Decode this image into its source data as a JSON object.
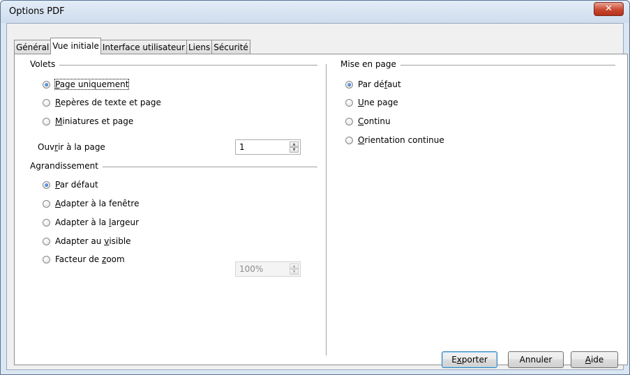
{
  "window": {
    "title": "Options PDF",
    "close_glyph": "✕"
  },
  "tabs": [
    "Général",
    "Vue initiale",
    "Interface utilisateur",
    "Liens",
    "Sécurité"
  ],
  "volets": {
    "title": "Volets",
    "options": [
      {
        "pre": "",
        "key": "P",
        "post": "age uniquement",
        "selected": true
      },
      {
        "pre": "",
        "key": "R",
        "post": "epères de texte et page",
        "selected": false
      },
      {
        "pre": "",
        "key": "M",
        "post": "iniatures et page",
        "selected": false
      }
    ],
    "open_page": {
      "pre": "Ouv",
      "key": "r",
      "post": "ir à la page",
      "value": "1"
    }
  },
  "agrandissement": {
    "title": "Agrandissement",
    "options": [
      {
        "pre": "",
        "key": "P",
        "post": "ar défaut",
        "selected": true
      },
      {
        "pre": "",
        "key": "A",
        "post": "dapter à la fenêtre",
        "selected": false
      },
      {
        "pre": "Adapter à la ",
        "key": "l",
        "post": "argeur",
        "selected": false
      },
      {
        "pre": "Adapter au ",
        "key": "v",
        "post": "isible",
        "selected": false
      },
      {
        "pre": "Facteur de ",
        "key": "z",
        "post": "oom",
        "selected": false
      }
    ],
    "zoom_value": "100%"
  },
  "mise_en_page": {
    "title": "Mise en page",
    "options": [
      {
        "pre": "Par dé",
        "key": "f",
        "post": "aut",
        "selected": true
      },
      {
        "pre": "",
        "key": "U",
        "post": "ne page",
        "selected": false
      },
      {
        "pre": "",
        "key": "C",
        "post": "ontinu",
        "selected": false
      },
      {
        "pre": "",
        "key": "O",
        "post": "rientation continue",
        "selected": false
      }
    ]
  },
  "buttons": {
    "export": {
      "pre": "E",
      "key": "x",
      "post": "porter"
    },
    "cancel": "Annuler",
    "help": {
      "pre": "",
      "key": "A",
      "post": "ide"
    }
  }
}
